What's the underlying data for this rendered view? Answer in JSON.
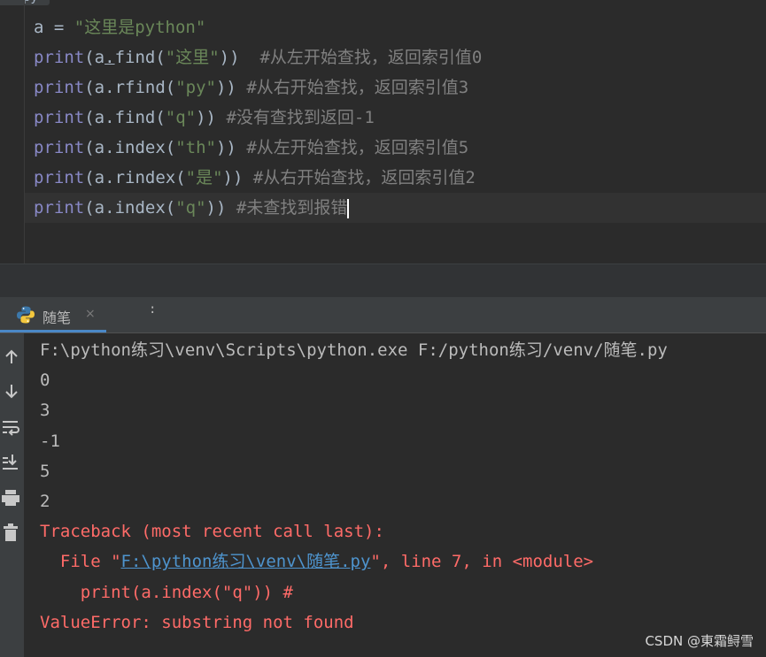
{
  "editor": {
    "tab_label": "py",
    "lines": [
      {
        "var": "a",
        "op": " = ",
        "str": "\"这里是python\""
      },
      {
        "fn": "print",
        "open": "(",
        "obj": "a",
        "dot": ".",
        "method": "find",
        "p1": "(",
        "arg": "\"这里\"",
        "p2": "))",
        "sp": "  ",
        "comment": "#从左开始查找，返回索引值0"
      },
      {
        "fn": "print",
        "open": "(",
        "obj": "a",
        "dot": ".",
        "method": "rfind",
        "p1": "(",
        "arg": "\"py\"",
        "p2": "))",
        "sp": " ",
        "comment": "#从右开始查找，返回索引值3"
      },
      {
        "fn": "print",
        "open": "(",
        "obj": "a",
        "dot": ".",
        "method": "find",
        "p1": "(",
        "arg": "\"q\"",
        "p2": "))",
        "sp": " ",
        "comment": "#没有查找到返回-1"
      },
      {
        "fn": "print",
        "open": "(",
        "obj": "a",
        "dot": ".",
        "method": "index",
        "p1": "(",
        "arg": "\"th\"",
        "p2": "))",
        "sp": " ",
        "comment": "#从左开始查找，返回索引值5"
      },
      {
        "fn": "print",
        "open": "(",
        "obj": "a",
        "dot": ".",
        "method": "rindex",
        "p1": "(",
        "arg": "\"是\"",
        "p2": "))",
        "sp": " ",
        "comment": "#从右开始查找，返回索引值2"
      },
      {
        "fn": "print",
        "open": "(",
        "obj": "a",
        "dot": ".",
        "method": "index",
        "p1": "(",
        "arg": "\"q\"",
        "p2": "))",
        "sp": " ",
        "comment": "#未查找到报错"
      }
    ]
  },
  "run_panel": {
    "tab_label": "随笔",
    "tab_close": "×",
    "header_dots": ":",
    "toolbar_icons": [
      "arrow-up-icon",
      "arrow-down-icon",
      "soft-wrap-icon",
      "scroll-to-end-icon",
      "print-icon",
      "trash-icon"
    ],
    "console": {
      "command": "F:\\python练习\\venv\\Scripts\\python.exe F:/python练习/venv/随笔.py",
      "outputs": [
        "0",
        "3",
        "-1",
        "5",
        "2"
      ],
      "traceback_header": "Traceback (most recent call last):",
      "file_prefix": "  File \"",
      "file_link": "F:\\python练习\\venv\\随笔.py",
      "file_suffix": "\", line 7, in <module>",
      "code_line": "    print(a.index(\"q\")) #",
      "error_line": "ValueError: substring not found"
    }
  },
  "watermark": "CSDN @東霜鲟雪",
  "colors": {
    "background": "#2b2b2b",
    "keyword": "#8888c6",
    "string": "#6a8759",
    "comment": "#808080",
    "error": "#ff6b68",
    "link": "#4e94ce",
    "tab_underline": "#4a88c7"
  }
}
